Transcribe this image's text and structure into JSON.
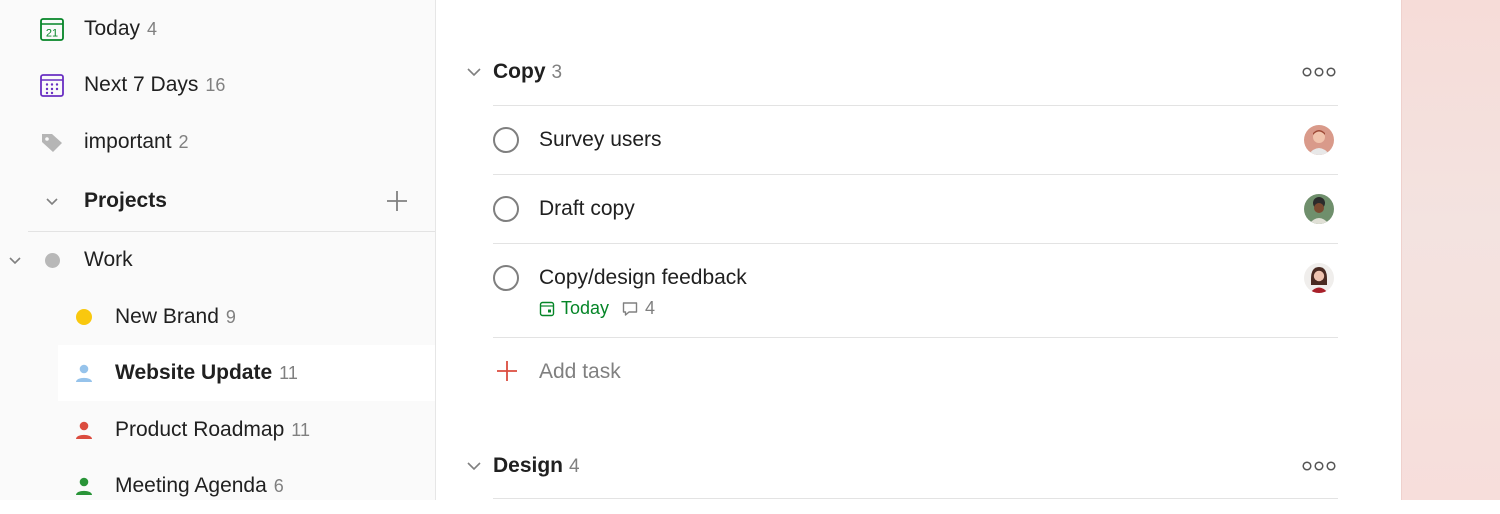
{
  "sidebar": {
    "items": [
      {
        "label": "Today",
        "count": "4",
        "icon": "calendar-today-icon",
        "icon_text": "21"
      },
      {
        "label": "Next 7 Days",
        "count": "16",
        "icon": "calendar-week-icon"
      },
      {
        "label": "important",
        "count": "2",
        "icon": "label-tag-icon"
      }
    ],
    "projects_header": {
      "label": "Projects",
      "add_icon": "plus-icon"
    },
    "work": {
      "label": "Work"
    },
    "projects": [
      {
        "label": "New Brand",
        "count": "9",
        "icon": "project-dot-icon",
        "color": "#f9c80e"
      },
      {
        "label": "Website Update",
        "count": "11",
        "icon": "person-icon",
        "color": "#96c3eb",
        "selected": true
      },
      {
        "label": "Product Roadmap",
        "count": "11",
        "icon": "person-icon",
        "color": "#db4c3f"
      },
      {
        "label": "Meeting Agenda",
        "count": "6",
        "icon": "person-icon",
        "color": "#299438"
      }
    ]
  },
  "main": {
    "sections": [
      {
        "title": "Copy",
        "count": "3",
        "tasks": [
          {
            "title": "Survey users",
            "avatar": "avatar-icon"
          },
          {
            "title": "Draft copy",
            "avatar": "avatar-icon"
          },
          {
            "title": "Copy/design feedback",
            "avatar": "avatar-icon",
            "due": "Today",
            "comments": "4"
          }
        ],
        "add_task": "Add task"
      },
      {
        "title": "Design",
        "count": "4"
      }
    ]
  },
  "colors": {
    "accent": "#db4c3f",
    "today_green": "#058527",
    "calendar_purple": "#692fc2",
    "selected_bg": "#ffffff"
  }
}
